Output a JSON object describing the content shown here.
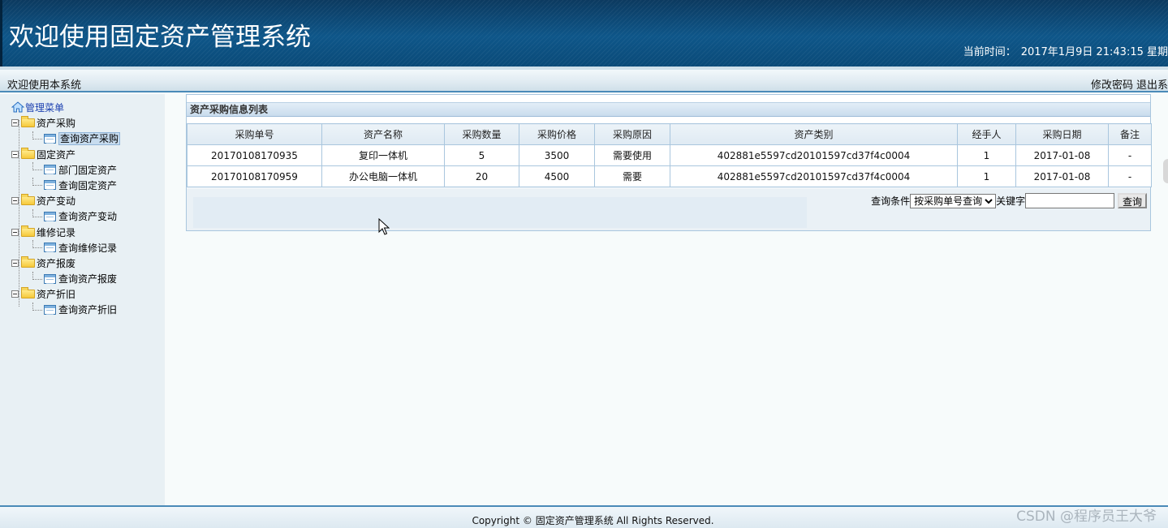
{
  "header": {
    "title": "欢迎使用固定资产管理系统",
    "time_label": "当前时间：",
    "time_value": "2017年1月9日 21:43:15 星期"
  },
  "subbar": {
    "welcome": "欢迎使用本系统",
    "change_password": "修改密码",
    "logout": "退出系"
  },
  "sidebar": {
    "root": "管理菜单",
    "groups": [
      {
        "label": "资产采购",
        "items": [
          "查询资产采购"
        ]
      },
      {
        "label": "固定资产",
        "items": [
          "部门固定资产",
          "查询固定资产"
        ]
      },
      {
        "label": "资产变动",
        "items": [
          "查询资产变动"
        ]
      },
      {
        "label": "维修记录",
        "items": [
          "查询维修记录"
        ]
      },
      {
        "label": "资产报废",
        "items": [
          "查询资产报废"
        ]
      },
      {
        "label": "资产折旧",
        "items": [
          "查询资产折旧"
        ]
      }
    ]
  },
  "panel": {
    "title": "资产采购信息列表",
    "columns": [
      "采购单号",
      "资产名称",
      "采购数量",
      "采购价格",
      "采购原因",
      "资产类别",
      "经手人",
      "采购日期",
      "备注"
    ],
    "rows": [
      [
        "20170108170935",
        "复印一体机",
        "5",
        "3500",
        "需要使用",
        "402881e5597cd20101597cd37f4c0004",
        "1",
        "2017-01-08",
        "-"
      ],
      [
        "20170108170959",
        "办公电脑一体机",
        "20",
        "4500",
        "需要",
        "402881e5597cd20101597cd37f4c0004",
        "1",
        "2017-01-08",
        "-"
      ]
    ],
    "search": {
      "condition_label": "查询条件",
      "condition_value": "按采购单号查询",
      "keyword_label": "关键字",
      "keyword_value": "",
      "button": "查询"
    }
  },
  "footer": {
    "copyright": "Copyright © 固定资产管理系统 All Rights Reserved."
  },
  "watermark": "CSDN @程序员王大爷",
  "colors": {
    "header_bg": "#0e5689",
    "accent_border": "#4a8ab8",
    "table_border": "#a9c6de",
    "tree_root": "#1a3fb0"
  }
}
